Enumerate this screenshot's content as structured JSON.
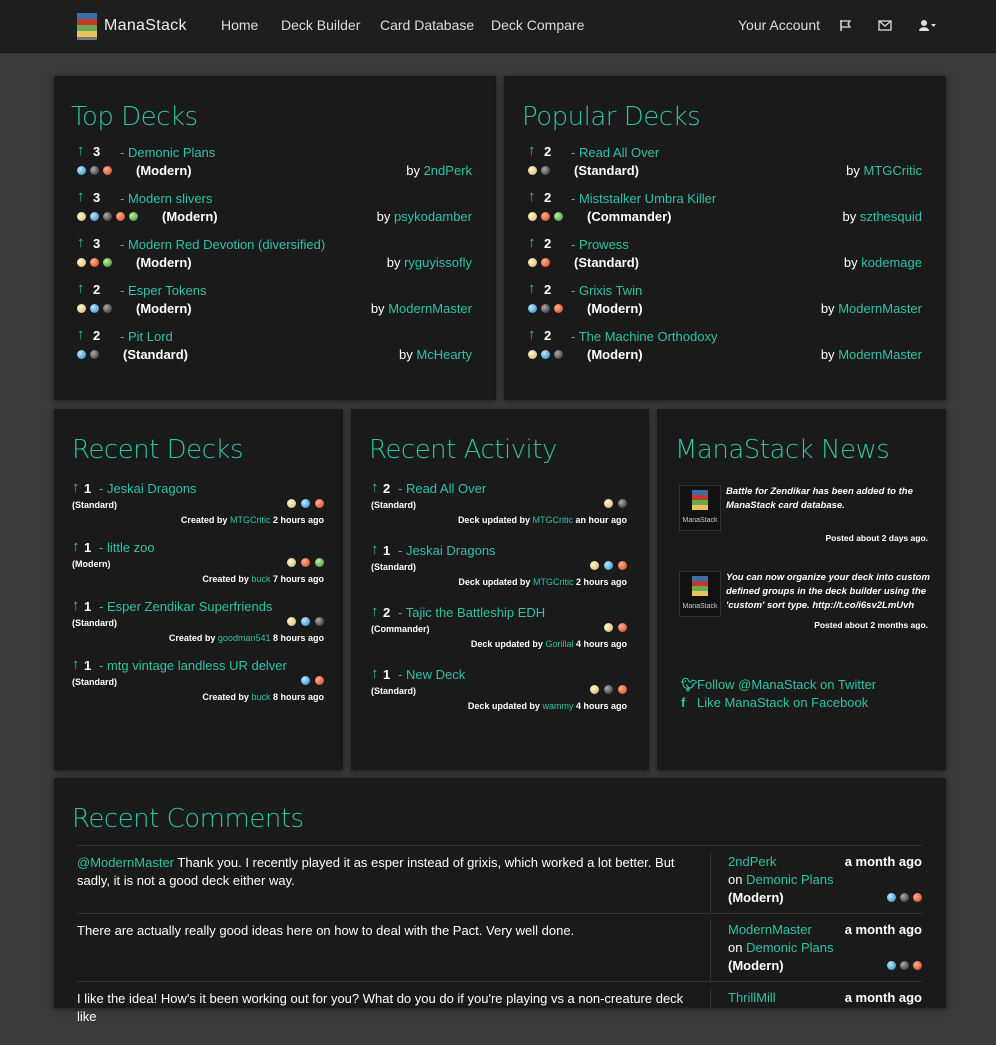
{
  "nav": {
    "brand": "ManaStack",
    "links": [
      "Home",
      "Deck Builder",
      "Card Database",
      "Deck Compare"
    ],
    "account": "Your Account",
    "icons": [
      "flag-icon",
      "envelope-icon",
      "user-icon"
    ]
  },
  "top_decks": {
    "title": "Top Decks",
    "items": [
      {
        "votes": "3",
        "name": "Demonic Plans",
        "format": "(Modern)",
        "by": "by",
        "author": "2ndPerk",
        "colors": [
          "u",
          "b",
          "r"
        ]
      },
      {
        "votes": "3",
        "name": "Modern slivers",
        "format": "(Modern)",
        "by": "by",
        "author": "psykodamber",
        "colors": [
          "w",
          "u",
          "b",
          "r",
          "g"
        ]
      },
      {
        "votes": "3",
        "name": "Modern Red Devotion (diversified)",
        "format": "(Modern)",
        "by": "by",
        "author": "ryguyissofly",
        "colors": [
          "w",
          "r",
          "g"
        ]
      },
      {
        "votes": "2",
        "name": "Esper Tokens",
        "format": "(Modern)",
        "by": "by",
        "author": "ModernMaster",
        "colors": [
          "w",
          "u",
          "b"
        ]
      },
      {
        "votes": "2",
        "name": "Pit Lord",
        "format": "(Standard)",
        "by": "by",
        "author": "McHearty",
        "colors": [
          "u",
          "b"
        ]
      }
    ]
  },
  "popular_decks": {
    "title": "Popular Decks",
    "items": [
      {
        "votes": "2",
        "name": "Read All Over",
        "format": "(Standard)",
        "by": "by",
        "author": "MTGCritic",
        "colors": [
          "w",
          "b"
        ]
      },
      {
        "votes": "2",
        "name": "Miststalker Umbra Killer",
        "format": "(Commander)",
        "by": "by",
        "author": "szthesquid",
        "colors": [
          "w",
          "r",
          "g"
        ]
      },
      {
        "votes": "2",
        "name": "Prowess",
        "format": "(Standard)",
        "by": "by",
        "author": "kodemage",
        "colors": [
          "w",
          "r"
        ]
      },
      {
        "votes": "2",
        "name": "Grixis Twin",
        "format": "(Modern)",
        "by": "by",
        "author": "ModernMaster",
        "colors": [
          "u",
          "b",
          "r"
        ]
      },
      {
        "votes": "2",
        "name": "The Machine Orthodoxy",
        "format": "(Modern)",
        "by": "by",
        "author": "ModernMaster",
        "colors": [
          "w",
          "u",
          "b"
        ]
      }
    ]
  },
  "recent_decks": {
    "title": "Recent Decks",
    "items": [
      {
        "votes": "1",
        "name": "Jeskai Dragons",
        "format": "(Standard)",
        "prefix": "Created by",
        "author": "MTGCritic",
        "time": "2 hours ago",
        "colors": [
          "w",
          "u",
          "r"
        ]
      },
      {
        "votes": "1",
        "name": "little zoo",
        "format": "(Modern)",
        "prefix": "Created by",
        "author": "buck",
        "time": "7 hours ago",
        "colors": [
          "w",
          "r",
          "g"
        ]
      },
      {
        "votes": "1",
        "name": "Esper Zendikar Superfriends",
        "format": "(Standard)",
        "prefix": "Created by",
        "author": "goodman541",
        "time": "8 hours ago",
        "colors": [
          "w",
          "u",
          "b"
        ]
      },
      {
        "votes": "1",
        "name": "mtg vintage landless UR delver",
        "format": "(Standard)",
        "prefix": "Created by",
        "author": "buck",
        "time": "8 hours ago",
        "colors": [
          "u",
          "r"
        ]
      }
    ]
  },
  "recent_activity": {
    "title": "Recent Activity",
    "items": [
      {
        "votes": "2",
        "name": "Read All Over",
        "format": "(Standard)",
        "prefix": "Deck updated by",
        "author": "MTGCritic",
        "time": "an hour ago",
        "colors": [
          "w",
          "b"
        ]
      },
      {
        "votes": "1",
        "name": "Jeskai Dragons",
        "format": "(Standard)",
        "prefix": "Deck updated by",
        "author": "MTGCritic",
        "time": "2 hours ago",
        "colors": [
          "w",
          "u",
          "r"
        ]
      },
      {
        "votes": "2",
        "name": "Tajic the Battleship EDH",
        "format": "(Commander)",
        "prefix": "Deck updated by",
        "author": "Gorillal",
        "time": "4 hours ago",
        "colors": [
          "w",
          "r"
        ]
      },
      {
        "votes": "1",
        "name": "New Deck",
        "format": "(Standard)",
        "prefix": "Deck updated by",
        "author": "wammy",
        "time": "4 hours ago",
        "colors": [
          "w",
          "b",
          "r"
        ]
      }
    ]
  },
  "news": {
    "title": "ManaStack News",
    "logo_label": "ManaStack",
    "items": [
      {
        "text": "Battle for Zendikar has been added to the ManaStack card database.",
        "date": "Posted about 2 days ago."
      },
      {
        "text": "You can now organize your deck into custom defined groups in the deck builder using the 'custom' sort type. http://t.co/i6sv2LmUvh",
        "date": "Posted about 2 months ago."
      }
    ],
    "twitter": "Follow @ManaStack on Twitter",
    "facebook": "Like ManaStack on Facebook"
  },
  "comments": {
    "title": "Recent Comments",
    "items": [
      {
        "mention": "@ModernMaster",
        "text": " Thank you. I recently played it as esper instead of grixis, which worked a lot better. But sadly, it is not a good deck either way.",
        "user": "2ndPerk",
        "when": "a month ago",
        "on": "on",
        "deck": "Demonic Plans",
        "format": "(Modern)",
        "colors": [
          "u",
          "b",
          "r"
        ]
      },
      {
        "mention": "",
        "text": "There are actually really good ideas here on how to deal with the Pact. Very well done.",
        "user": "ModernMaster",
        "when": "a month ago",
        "on": "on",
        "deck": "Demonic Plans",
        "format": "(Modern)",
        "colors": [
          "u",
          "b",
          "r"
        ]
      },
      {
        "mention": "",
        "text": "I like the idea! How's it been working out for you? What do you do if you're playing vs a non-creature deck like",
        "user": "ThrillMill",
        "when": "a month ago",
        "on": "",
        "deck": "",
        "format": "",
        "colors": []
      }
    ]
  }
}
